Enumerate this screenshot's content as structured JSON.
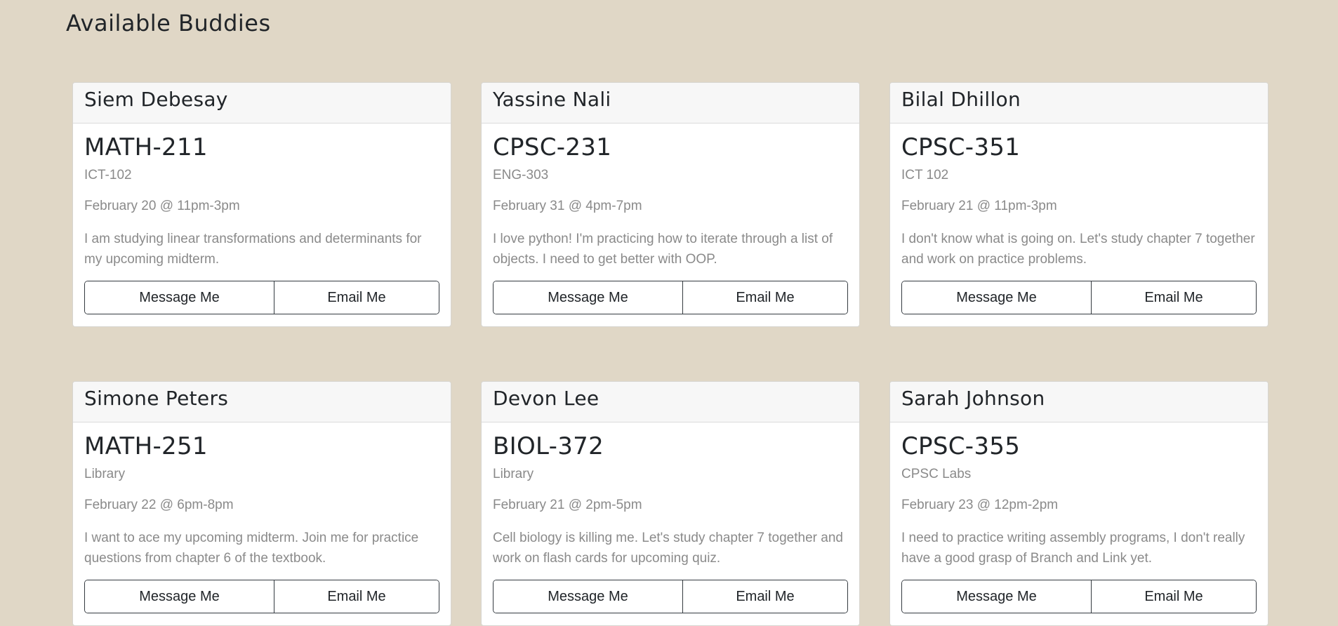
{
  "page": {
    "title": "Available Buddies"
  },
  "cards": [
    {
      "name": "Siem Debesay",
      "course": "MATH-211",
      "location": "ICT-102",
      "datetime": "February 20 @ 11pm-3pm",
      "description": "I am studying linear transformations and determinants for my upcoming midterm.",
      "message_label": "Message Me",
      "email_label": "Email Me"
    },
    {
      "name": "Yassine Nali",
      "course": "CPSC-231",
      "location": "ENG-303",
      "datetime": "February 31 @ 4pm-7pm",
      "description": "I love python! I'm practicing how to iterate through a list of objects. I need to get better with OOP.",
      "message_label": "Message Me",
      "email_label": "Email Me"
    },
    {
      "name": "Bilal Dhillon",
      "course": "CPSC-351",
      "location": "ICT 102",
      "datetime": "February 21 @ 11pm-3pm",
      "description": "I don't know what is going on. Let's study chapter 7 together and work on practice problems.",
      "message_label": "Message Me",
      "email_label": "Email Me"
    },
    {
      "name": "Simone Peters",
      "course": "MATH-251",
      "location": "Library",
      "datetime": "February 22 @ 6pm-8pm",
      "description": "I want to ace my upcoming midterm. Join me for practice questions from chapter 6 of the textbook.",
      "message_label": "Message Me",
      "email_label": "Email Me"
    },
    {
      "name": "Devon Lee",
      "course": "BIOL-372",
      "location": "Library",
      "datetime": "February 21 @ 2pm-5pm",
      "description": "Cell biology is killing me. Let's study chapter 7 together and work on flash cards for upcoming quiz.",
      "message_label": "Message Me",
      "email_label": "Email Me"
    },
    {
      "name": "Sarah Johnson",
      "course": "CPSC-355",
      "location": "CPSC Labs",
      "datetime": "February 23 @ 12pm-2pm",
      "description": "I need to practice writing assembly programs, I don't really have a good grasp of Branch and Link yet.",
      "message_label": "Message Me",
      "email_label": "Email Me"
    }
  ],
  "colors": {
    "background": "#e0d7c6",
    "card": "#ffffff",
    "card_header": "#f7f7f7",
    "muted_text": "#8a8a8a",
    "button_border": "#343a40"
  }
}
